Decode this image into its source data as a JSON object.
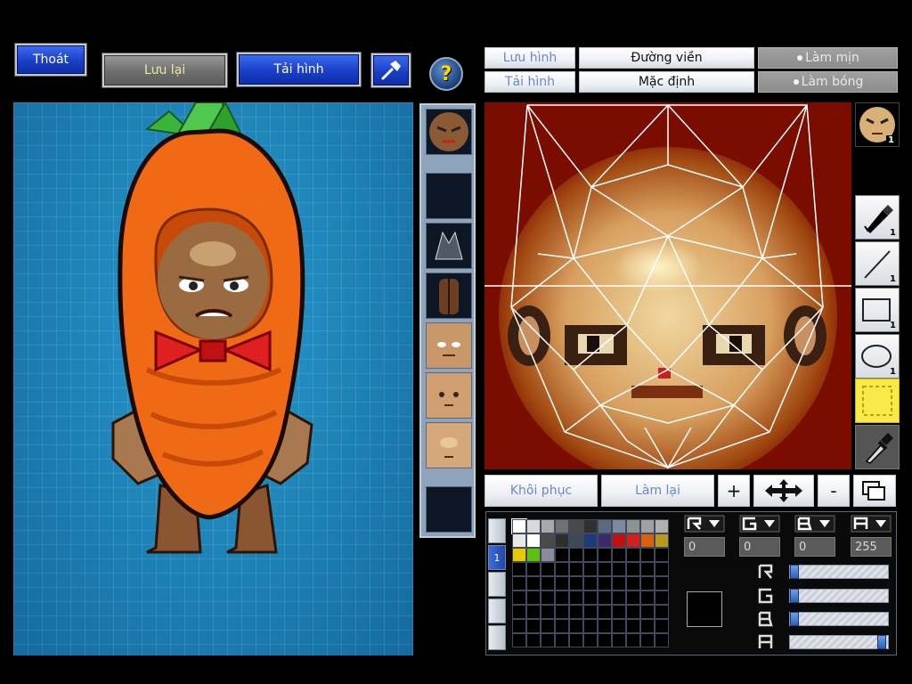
{
  "top_left": {
    "exit_label": "Thoát",
    "save_label": "Lưu lại",
    "load_label": "Tải hình",
    "tool_icon": "hammer-icon",
    "help_icon": "question-icon"
  },
  "right_header": {
    "save_image": "Lưu hình",
    "load_image": "Tải hình",
    "outline": "Đường viền",
    "default": "Mặc định",
    "smooth": "Làm mịn",
    "shade": "Làm bóng"
  },
  "tools": {
    "layer_number": "1",
    "pen_number": "1",
    "line_number": "1",
    "rect_number": "1",
    "ellipse_number": "1"
  },
  "bottom_bar": {
    "restore": "Khôi phục",
    "redo": "Làm lại",
    "plus": "+",
    "minus": "-"
  },
  "palette": {
    "colors": [
      "#ffffff",
      "#d8d8d8",
      "#a8a8a8",
      "#707070",
      "#484848",
      "#303030",
      "#5a6a80",
      "#7a8aa0",
      "#909090",
      "#a0a0a0",
      "#b0b0b0",
      "#e8e8e8",
      "#ffffff",
      "#4a4a4a",
      "#2e2e2e",
      "#404858",
      "#1e3a7a",
      "#3a2a6a",
      "#c01010",
      "#d02020",
      "#d86010",
      "#b89a20",
      "#e8c800",
      "#60c010",
      "#8a8a9a"
    ],
    "side_tab_label": "1"
  },
  "channels": {
    "r_value": "0",
    "g_value": "0",
    "b_value": "0",
    "a_value": "255",
    "r_level": 0,
    "g_level": 0,
    "b_level": 0,
    "a_level": 1.0
  },
  "accent": {
    "canvas_bg": "#7a0c00",
    "preview_bg": "#1e8ec4",
    "button_blue": "#1a3fc8"
  }
}
